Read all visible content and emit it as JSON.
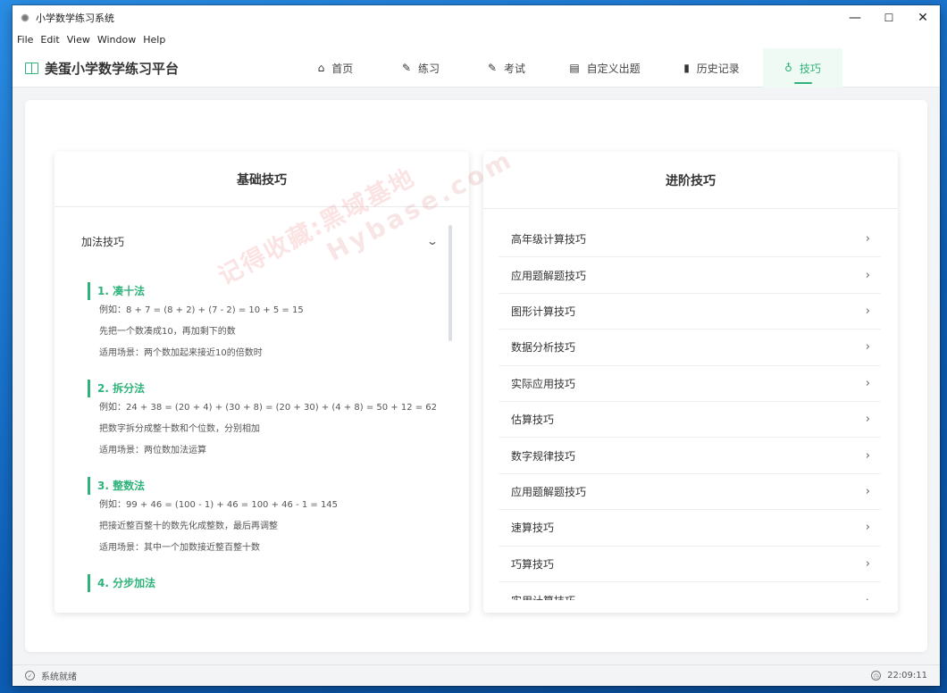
{
  "window": {
    "title": "小学数学练习系统",
    "controls": {
      "minimize": "—",
      "maximize": "☐",
      "close": "✕"
    }
  },
  "menu": [
    "File",
    "Edit",
    "View",
    "Window",
    "Help"
  ],
  "header": {
    "brand": "美蛋小学数学练习平台",
    "nav": [
      {
        "label": "首页",
        "icon": "home-icon",
        "glyph": "⌂",
        "active": false
      },
      {
        "label": "练习",
        "icon": "edit-icon",
        "glyph": "✎",
        "active": false
      },
      {
        "label": "考试",
        "icon": "edit-square-icon",
        "glyph": "✎",
        "active": false
      },
      {
        "label": "自定义出题",
        "icon": "document-icon",
        "glyph": "▤",
        "active": false
      },
      {
        "label": "历史记录",
        "icon": "bar-chart-icon",
        "glyph": "▮",
        "active": false
      },
      {
        "label": "技巧",
        "icon": "lightbulb-icon",
        "glyph": "♁",
        "active": true
      }
    ],
    "accent_color": "#2fb37a"
  },
  "basic": {
    "title": "基础技巧",
    "section_label": "加法技巧",
    "tips": [
      {
        "title": "1. 凑十法",
        "lines": [
          "例如：8 + 7 = (8 + 2) + (7 - 2) = 10 + 5 = 15",
          "先把一个数凑成10，再加剩下的数",
          "适用场景：两个数加起来接近10的倍数时"
        ]
      },
      {
        "title": "2. 拆分法",
        "lines": [
          "例如：24 + 38 = (20 + 4) + (30 + 8) = (20 + 30) + (4 + 8) = 50 + 12 = 62",
          "把数字拆分成整十数和个位数，分别相加",
          "适用场景：两位数加法运算"
        ]
      },
      {
        "title": "3. 整数法",
        "lines": [
          "例如：99 + 46 = (100 - 1) + 46 = 100 + 46 - 1 = 145",
          "把接近整百整十的数先化成整数，最后再调整",
          "适用场景：其中一个加数接近整百整十数"
        ]
      },
      {
        "title": "4. 分步加法",
        "lines": []
      }
    ]
  },
  "advanced": {
    "title": "进阶技巧",
    "items": [
      "高年级计算技巧",
      "应用题解题技巧",
      "图形计算技巧",
      "数据分析技巧",
      "实际应用技巧",
      "估算技巧",
      "数字规律技巧",
      "应用题解题技巧",
      "速算技巧",
      "巧算技巧",
      "实用计算技巧"
    ]
  },
  "watermark": {
    "line1": "记得收藏:黑域基地",
    "line2": "Hybase.com"
  },
  "status": {
    "text": "系统就绪",
    "time": "22:09:11"
  }
}
